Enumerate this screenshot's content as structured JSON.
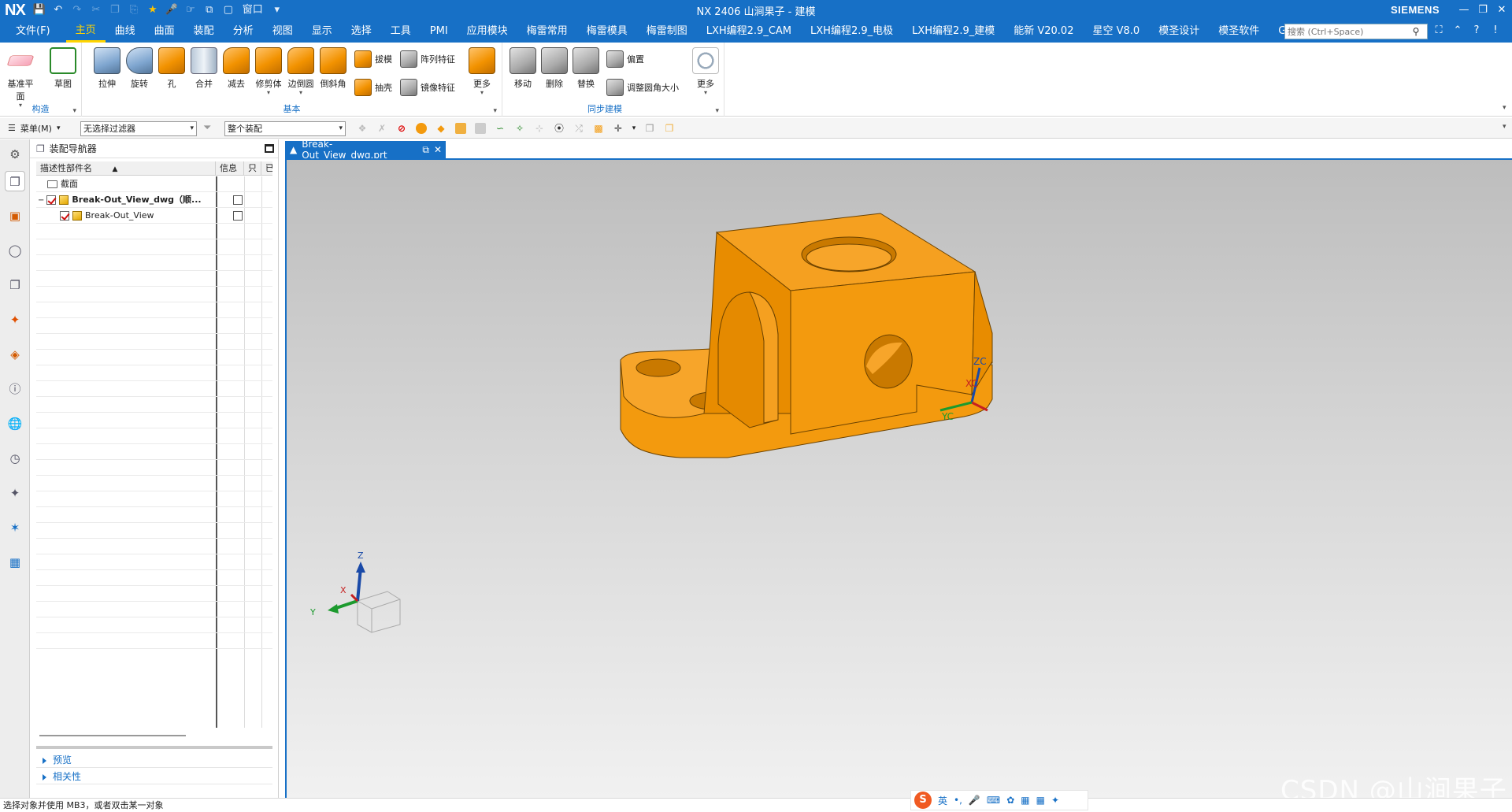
{
  "window": {
    "logo": "NX",
    "title": "NX 2406 山涧果子 - 建模",
    "brand": "SIEMENS",
    "window_menu": "窗口"
  },
  "menubar": {
    "file": "文件(F)",
    "tabs": [
      "主页",
      "曲线",
      "曲面",
      "装配",
      "分析",
      "视图",
      "显示",
      "选择",
      "工具",
      "PMI",
      "应用模块",
      "梅雷常用",
      "梅雷模具",
      "梅雷制图",
      "LXH编程2.9_CAM",
      "LXH编程2.9_电极",
      "LXH编程2.9_建模",
      "能新 V20.02",
      "星空 V8.0",
      "模圣设计",
      "模圣软件",
      "GC工具箱"
    ],
    "active_tab": "主页",
    "search_placeholder": "搜索 (Ctrl+Space)"
  },
  "ribbon": {
    "groups": {
      "construct": "构造",
      "basic": "基本",
      "sync": "同步建模"
    },
    "buttons": {
      "datum_plane": "基准平面",
      "sketch": "草图",
      "extrude": "拉伸",
      "revolve": "旋转",
      "hole": "孔",
      "unite": "合并",
      "subtract": "减去",
      "trim_body": "修剪体",
      "edge_blend": "边倒圆",
      "chamfer": "倒斜角",
      "draft": "拔模",
      "pattern_feature": "阵列特征",
      "shell": "抽壳",
      "mirror_feature": "镜像特征",
      "more1": "更多",
      "move": "移动",
      "delete": "删除",
      "replace": "替换",
      "offset": "偏置",
      "resize_blend": "调整圆角大小",
      "more2": "更多"
    }
  },
  "selbar": {
    "menu": "菜单(M)",
    "filter": "无选择过滤器",
    "scope": "整个装配"
  },
  "navigator": {
    "title": "装配导航器",
    "columns": [
      "描述性部件名",
      "信息",
      "只",
      "已"
    ],
    "rows": [
      {
        "name": "截面"
      },
      {
        "name": "Break-Out_View_dwg（顺..."
      },
      {
        "name": "Break-Out_View"
      }
    ],
    "panels": [
      "预览",
      "相关性"
    ]
  },
  "graphics": {
    "tab_label": "Break-Out_View_dwg.prt",
    "wcs": {
      "zc": "ZC",
      "xc": "XC",
      "yc": "YC"
    },
    "triad": {
      "z": "Z",
      "x": "X",
      "y": "Y"
    },
    "watermark": "CSDN @山涧果子",
    "model_color": "#f39a0e",
    "accent": "#1770c6"
  },
  "status": {
    "text": "选择对象并使用 MB3，或者双击某一对象"
  },
  "ime": {
    "logo": "S",
    "lang": "英"
  }
}
